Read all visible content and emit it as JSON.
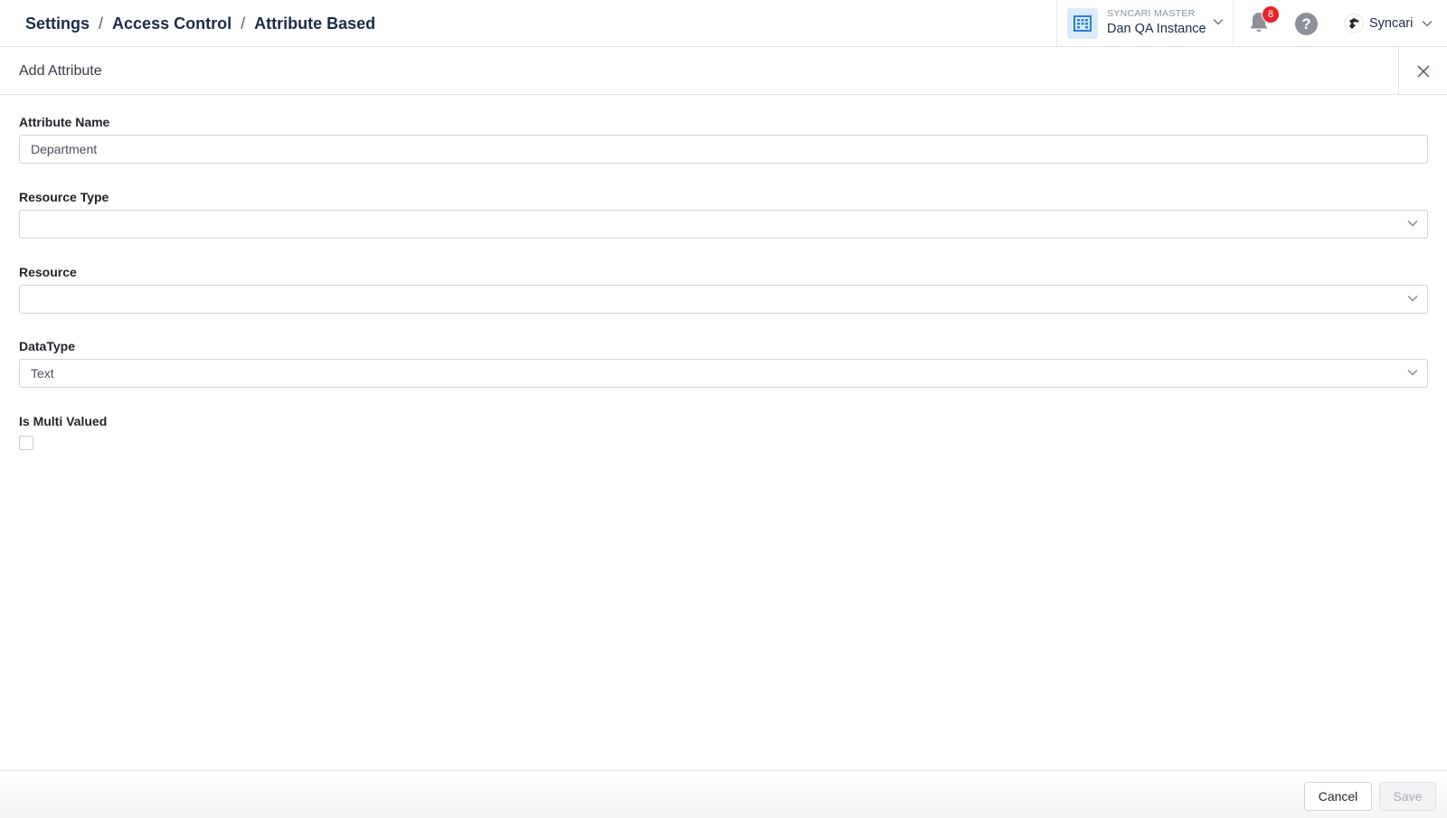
{
  "header": {
    "breadcrumb": [
      "Settings",
      "Access Control",
      "Attribute Based"
    ],
    "instance": {
      "top_label": "SYNCARI MASTER",
      "name": "Dan QA Instance"
    },
    "notifications_count": "8",
    "help_symbol": "?",
    "user_name": "Syncari",
    "icons": {
      "instance": "building-icon",
      "notifications": "bell-icon",
      "help": "help-icon",
      "user": "avatar-icon"
    }
  },
  "panel": {
    "title": "Add Attribute",
    "close_icon": "close-icon"
  },
  "form": {
    "attribute_name": {
      "label": "Attribute Name",
      "value": "Department"
    },
    "resource_type": {
      "label": "Resource Type",
      "value": ""
    },
    "resource": {
      "label": "Resource",
      "value": ""
    },
    "data_type": {
      "label": "DataType",
      "value": "Text"
    },
    "is_multi_valued": {
      "label": "Is Multi Valued",
      "checked": false
    }
  },
  "footer": {
    "cancel_label": "Cancel",
    "save_label": "Save"
  },
  "colors": {
    "primary_text": "#1c2b4b",
    "badge": "#e8242b",
    "instance_icon_bg": "#dcebfb",
    "instance_icon": "#2a7de1",
    "border": "#cfd3d9"
  }
}
